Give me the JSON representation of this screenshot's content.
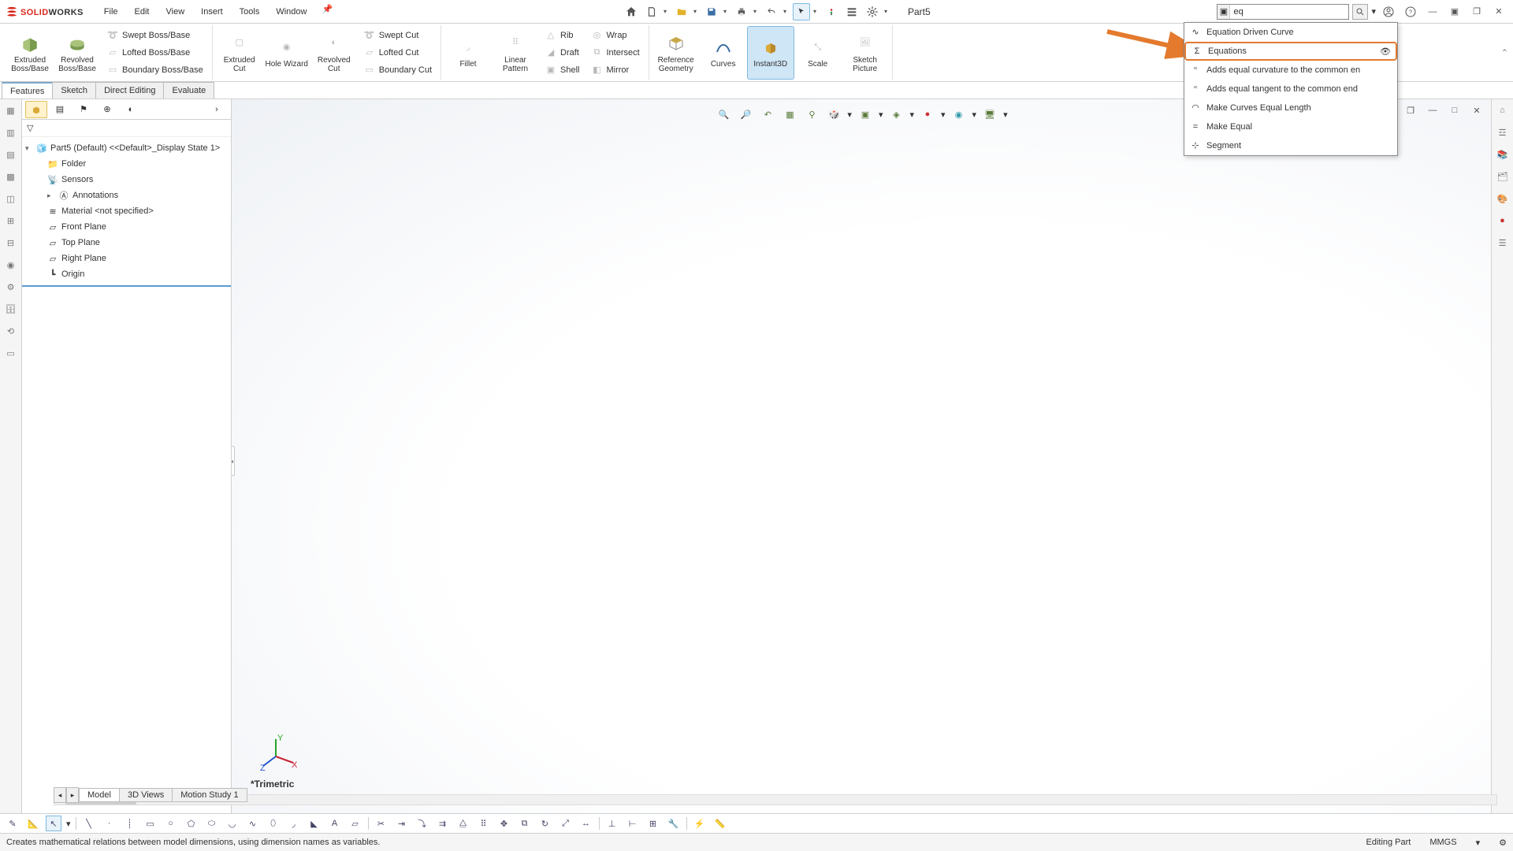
{
  "app": {
    "name_solid": "SOLID",
    "name_works": "WORKS"
  },
  "menubar": {
    "file": "File",
    "edit": "Edit",
    "view": "View",
    "insert": "Insert",
    "tools": "Tools",
    "window": "Window"
  },
  "document_title": "Part5",
  "search": {
    "value": "eq"
  },
  "ribbon": {
    "extruded_boss": "Extruded Boss/Base",
    "revolved_boss": "Revolved Boss/Base",
    "swept_boss": "Swept Boss/Base",
    "lofted_boss": "Lofted Boss/Base",
    "boundary_boss": "Boundary Boss/Base",
    "extruded_cut": "Extruded Cut",
    "hole_wizard": "Hole Wizard",
    "revolved_cut": "Revolved Cut",
    "swept_cut": "Swept Cut",
    "lofted_cut": "Lofted Cut",
    "boundary_cut": "Boundary Cut",
    "fillet": "Fillet",
    "linear_pattern": "Linear Pattern",
    "rib": "Rib",
    "draft": "Draft",
    "shell": "Shell",
    "wrap": "Wrap",
    "intersect": "Intersect",
    "mirror": "Mirror",
    "ref_geometry": "Reference Geometry",
    "curves": "Curves",
    "instant3d": "Instant3D",
    "scale": "Scale",
    "sketch_picture": "Sketch Picture"
  },
  "tabs": {
    "features": "Features",
    "sketch": "Sketch",
    "direct_editing": "Direct Editing",
    "evaluate": "Evaluate"
  },
  "tree": {
    "root": "Part5 (Default) <<Default>_Display State 1>",
    "folder": "Folder",
    "sensors": "Sensors",
    "annotations": "Annotations",
    "material": "Material <not specified>",
    "front": "Front Plane",
    "top": "Top Plane",
    "right": "Right Plane",
    "origin": "Origin"
  },
  "viewport": {
    "orientation": "*Trimetric"
  },
  "model_tabs": {
    "model": "Model",
    "views3d": "3D Views",
    "motion": "Motion Study 1"
  },
  "suggest": {
    "eq_curve": "Equation Driven Curve",
    "equations": "Equations",
    "eq_curvature": "Adds equal curvature to the common en",
    "eq_tangent": "Adds equal tangent to the common end",
    "eq_length": "Make Curves Equal Length",
    "make_equal": "Make Equal",
    "segment": "Segment"
  },
  "statusbar": {
    "hint": "Creates mathematical relations between model dimensions, using dimension names as variables.",
    "mode": "Editing Part",
    "units": "MMGS"
  }
}
